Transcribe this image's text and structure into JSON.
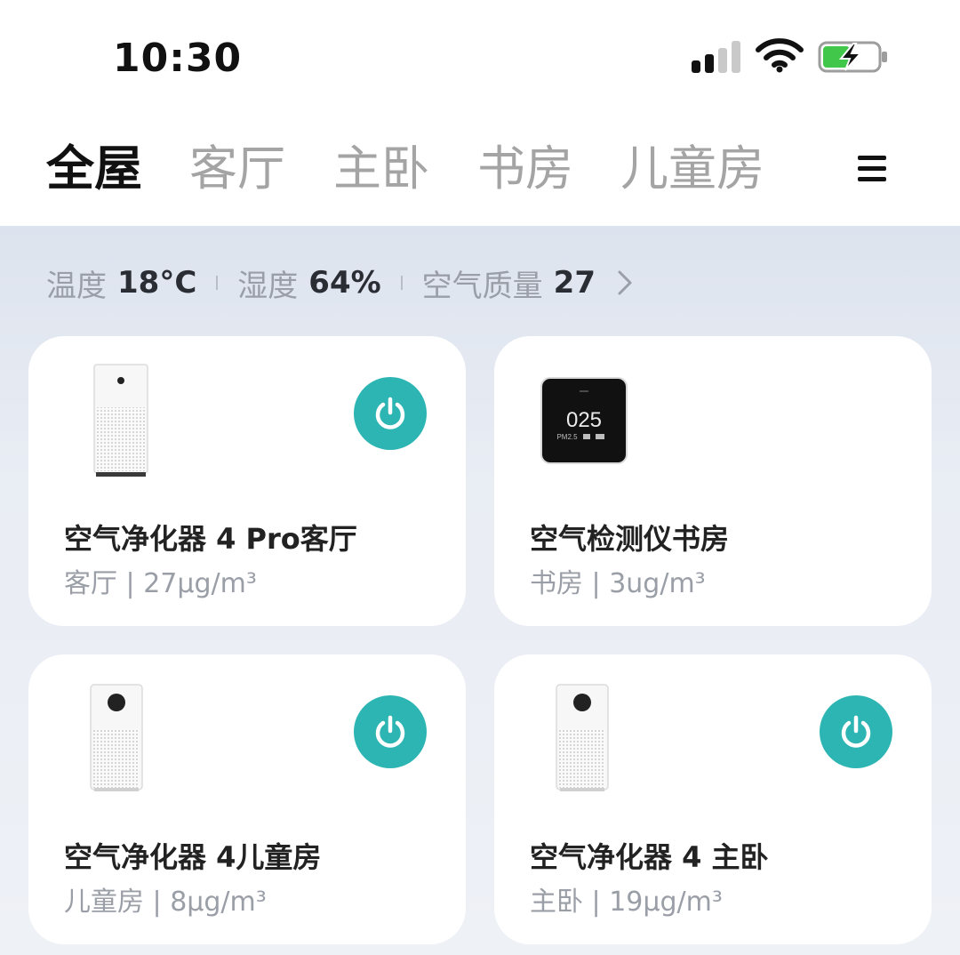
{
  "status_bar": {
    "time": "10:30"
  },
  "tabs": [
    {
      "label": "全屋",
      "active": true
    },
    {
      "label": "客厅",
      "active": false
    },
    {
      "label": "主卧",
      "active": false
    },
    {
      "label": "书房",
      "active": false
    },
    {
      "label": "儿童房",
      "active": false
    }
  ],
  "menu_icon": "hamburger-menu-icon",
  "environment": {
    "temperature_label": "温度",
    "temperature_value": "18°C",
    "humidity_label": "湿度",
    "humidity_value": "64%",
    "air_label": "空气质量",
    "air_value": "27"
  },
  "devices": [
    {
      "name": "空气净化器 4 Pro客厅",
      "room": "客厅",
      "reading": "27μg/m³",
      "has_power": true,
      "icon": "air-purifier-pro"
    },
    {
      "name": "空气检测仪书房",
      "room": "书房",
      "reading": "3ug/m³",
      "has_power": false,
      "icon": "air-monitor",
      "display_value": "025",
      "display_sub": "PM2.5"
    },
    {
      "name": "空气净化器 4儿童房",
      "room": "儿童房",
      "reading": "8μg/m³",
      "has_power": true,
      "icon": "air-purifier"
    },
    {
      "name": "空气净化器 4 主卧",
      "room": "主卧",
      "reading": "19μg/m³",
      "has_power": true,
      "icon": "air-purifier"
    }
  ],
  "separator": "|",
  "colors": {
    "accent": "#2db5b4",
    "background": "#e9edf4",
    "card": "#ffffff",
    "text_primary": "#222222",
    "text_secondary": "#9a9ea6"
  }
}
